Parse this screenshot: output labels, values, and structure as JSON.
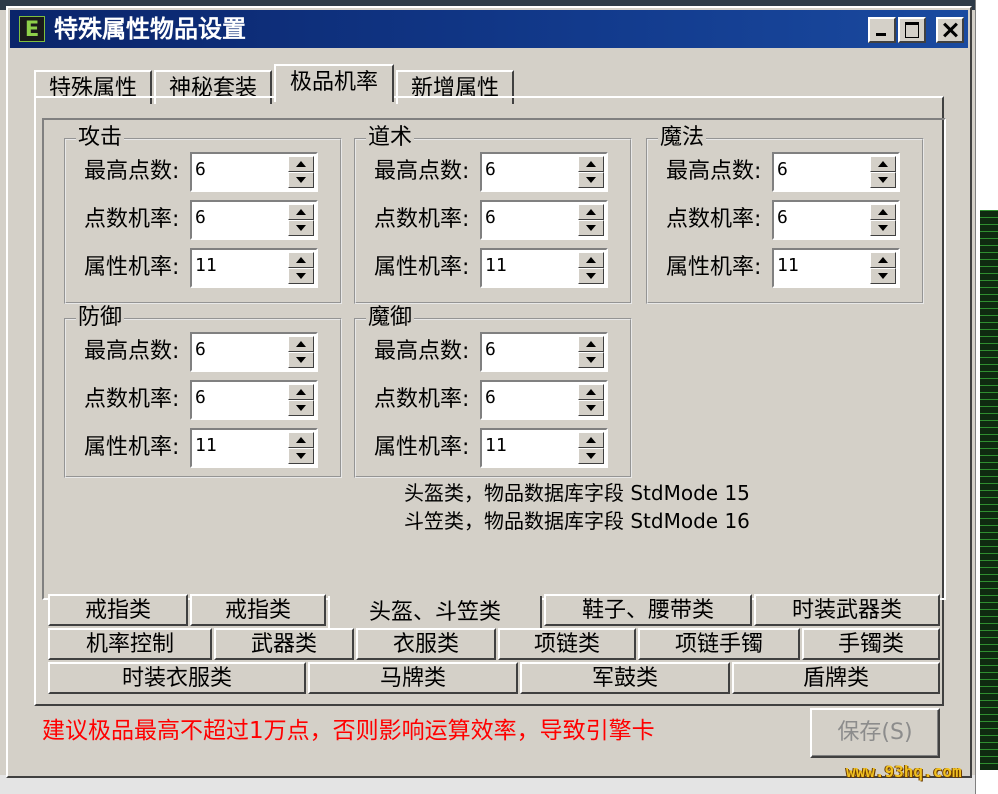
{
  "window": {
    "title": "特殊属性物品设置",
    "icon_letter": "E",
    "icon": "app-e-icon",
    "buttons": {
      "minimize": "minimize-icon",
      "maximize": "maximize-icon",
      "close": "close-icon"
    }
  },
  "top_tabs": [
    {
      "label": "特殊属性",
      "active": false
    },
    {
      "label": "神秘套装",
      "active": false
    },
    {
      "label": "极品机率",
      "active": true
    },
    {
      "label": "新增属性",
      "active": false
    }
  ],
  "groups": [
    {
      "title": "攻击",
      "fields": [
        {
          "label": "最高点数:",
          "value": "6"
        },
        {
          "label": "点数机率:",
          "value": "6"
        },
        {
          "label": "属性机率:",
          "value": "11"
        }
      ]
    },
    {
      "title": "道术",
      "fields": [
        {
          "label": "最高点数:",
          "value": "6"
        },
        {
          "label": "点数机率:",
          "value": "6"
        },
        {
          "label": "属性机率:",
          "value": "11"
        }
      ]
    },
    {
      "title": "魔法",
      "fields": [
        {
          "label": "最高点数:",
          "value": "6"
        },
        {
          "label": "点数机率:",
          "value": "6"
        },
        {
          "label": "属性机率:",
          "value": "11"
        }
      ]
    },
    {
      "title": "防御",
      "fields": [
        {
          "label": "最高点数:",
          "value": "6"
        },
        {
          "label": "点数机率:",
          "value": "6"
        },
        {
          "label": "属性机率:",
          "value": "11"
        }
      ]
    },
    {
      "title": "魔御",
      "fields": [
        {
          "label": "最高点数:",
          "value": "6"
        },
        {
          "label": "点数机率:",
          "value": "6"
        },
        {
          "label": "属性机率:",
          "value": "11"
        }
      ]
    }
  ],
  "info": [
    "头盔类，物品数据库字段 StdMode 15",
    "斗笠类，物品数据库字段 StdMode 16"
  ],
  "bottom_tabs": {
    "row1": [
      {
        "label": "戒指类",
        "active": false
      },
      {
        "label": "戒指类",
        "active": false
      },
      {
        "label": "头盔、斗笠类",
        "active": true
      },
      {
        "label": "鞋子、腰带类",
        "active": false
      },
      {
        "label": "时装武器类",
        "active": false
      }
    ],
    "row2": [
      {
        "label": "机率控制",
        "active": false
      },
      {
        "label": "武器类",
        "active": false
      },
      {
        "label": "衣服类",
        "active": false
      },
      {
        "label": "项链类",
        "active": false
      },
      {
        "label": "项链手镯",
        "active": false
      },
      {
        "label": "手镯类",
        "active": false
      }
    ],
    "row3": [
      {
        "label": "时装衣服类",
        "active": false
      },
      {
        "label": "马牌类",
        "active": false
      },
      {
        "label": "军鼓类",
        "active": false
      },
      {
        "label": "盾牌类",
        "active": false
      }
    ]
  },
  "warning": "建议极品最高不超过1万点，否则影响运算效率，导致引擎卡",
  "save_button": "保存(S)",
  "watermark": "www.93hq.com",
  "colors": {
    "title_bar": "#0a246a",
    "face": "#d4d0c8",
    "warning": "#ff0000",
    "disabled_text": "#8c8c8c",
    "watermark": "#f0c020"
  }
}
